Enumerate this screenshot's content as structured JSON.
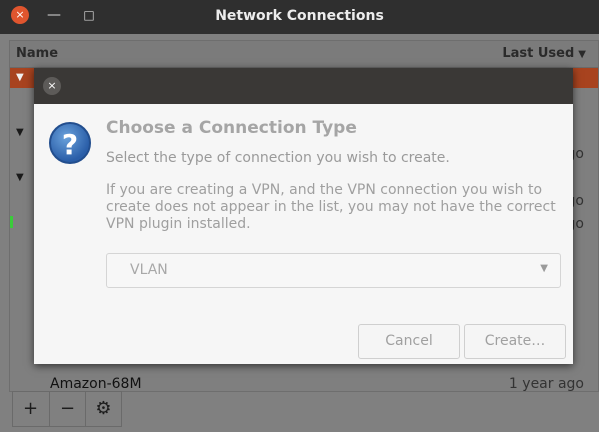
{
  "window": {
    "title": "Network Connections",
    "close_glyph": "×",
    "minimize_glyph": "—",
    "maximize_glyph": "□"
  },
  "list": {
    "col_name": "Name",
    "col_last_used": "Last Used",
    "sort_glyph": "▼",
    "rows": [
      {
        "name": "Amazon-68M",
        "last_used": "1 year ago"
      }
    ],
    "partial_times": [
      "ago",
      "ago",
      "ago"
    ]
  },
  "toolbar": {
    "add_glyph": "+",
    "remove_glyph": "−",
    "settings_glyph": "⚙"
  },
  "dialog": {
    "close_glyph": "×",
    "icon_glyph": "?",
    "heading": "Choose a Connection Type",
    "subtitle": "Select the type of connection you wish to create.",
    "info": "If you are creating a VPN, and the VPN connection you wish to create does not appear in the list, you may not have the correct VPN plugin installed.",
    "combo_value": "VLAN",
    "combo_arrow": "▼",
    "cancel_label": "Cancel",
    "create_label": "Create…"
  },
  "colors": {
    "selection": "#a8431f",
    "close_button": "#e0552e",
    "question_icon": "#2a5ea8"
  }
}
